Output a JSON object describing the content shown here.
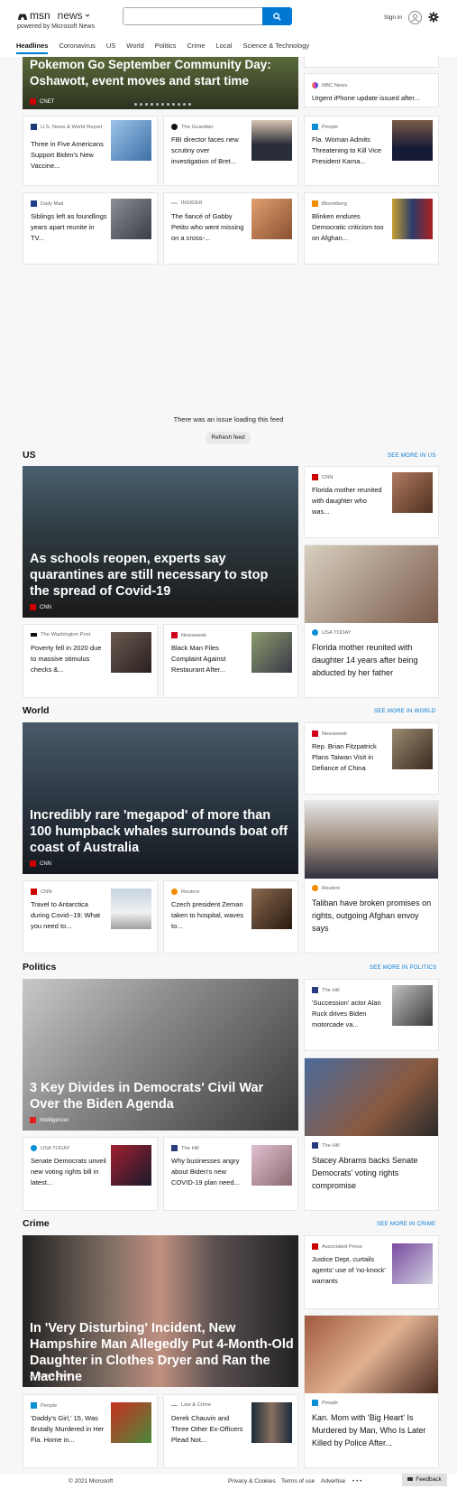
{
  "header": {
    "brand": "msn",
    "section": "news",
    "powered_by": "powered by Microsoft News",
    "search_value": "",
    "sign_in": "Sign in"
  },
  "nav": [
    "Headlines",
    "Coronavirus",
    "US",
    "World",
    "Politics",
    "Crime",
    "Local",
    "Science & Technology"
  ],
  "top": {
    "hero_title": "Pokemon Go September Community Day: Oshawott, event moves and start time",
    "hero_source": "CNET",
    "right_source": "NBC News",
    "right_title": "Urgent iPhone update issued after..."
  },
  "row1": [
    {
      "source": "U.S. News & World Report",
      "title": "Three in Five Americans Support Biden's New Vaccine..."
    },
    {
      "source": "The Guardian",
      "title": "FBI director faces new scrutiny over investigation of Bret..."
    },
    {
      "source": "People",
      "title": "Fla. Woman Admits Threatening to Kill Vice President Kama..."
    }
  ],
  "row2": [
    {
      "source": "Daily Mail",
      "title": "Siblings left as foundlings years apart reunite in TV..."
    },
    {
      "source": "INSIDER",
      "title": "The fiancé of Gabby Petito who went missing on a cross-..."
    },
    {
      "source": "Bloomberg",
      "title": "Blinken endures Democratic criticism too on Afghan..."
    }
  ],
  "feed_issue": "There was an issue loading this feed",
  "refresh": "Refresh feed",
  "sections": [
    {
      "heading": "US",
      "see_more": "SEE MORE IN US",
      "hero_title": "As schools reopen, experts say quarantines are still necessary to stop the spread of Covid-19",
      "hero_source": "CNN",
      "side_small": {
        "source": "CNN",
        "title": "Florida mother reunited with daughter who was..."
      },
      "side_big": {
        "source": "USA TODAY",
        "title": "Florida mother reunited with daughter 14 years after being abducted by her father"
      },
      "bottom": [
        {
          "source": "The Washington Post",
          "title": "Poverty fell in 2020 due to massive stimulus checks &..."
        },
        {
          "source": "Newsweek",
          "title": "Black Man Files Complaint Against Restaurant After..."
        }
      ]
    },
    {
      "heading": "World",
      "see_more": "SEE MORE IN WORLD",
      "hero_title": "Incredibly rare 'megapod' of more than 100 humpback whales surrounds boat off coast of Australia",
      "hero_source": "CNN",
      "side_small": {
        "source": "Newsweek",
        "title": "Rep. Brian Fitzpatrick Plans Taiwan Visit in Defiance of China"
      },
      "side_big": {
        "source": "Reuters",
        "title": "Taliban have broken promises on rights, outgoing Afghan envoy says"
      },
      "bottom": [
        {
          "source": "CNN",
          "title": "Travel to Antarctica during Covid--19: What you need to..."
        },
        {
          "source": "Reuters",
          "title": "Czech president Zeman taken to hospital, waves to..."
        }
      ]
    },
    {
      "heading": "Politics",
      "see_more": "SEE MORE IN POLITICS",
      "hero_title": "3 Key Divides in Democrats' Civil War Over the Biden Agenda",
      "hero_source": "Intelligencer",
      "side_small": {
        "source": "The Hill",
        "title": "'Succession' actor Alan Ruck drives Biden motorcade va..."
      },
      "side_big": {
        "source": "The Hill",
        "title": "Stacey Abrams backs Senate Democrats' voting rights compromise"
      },
      "bottom": [
        {
          "source": "USA TODAY",
          "title": "Senate Democrats unveil new voting rights bill in latest..."
        },
        {
          "source": "The Hill",
          "title": "Why businesses angry about Biden's new COVID-19 plan need..."
        }
      ]
    },
    {
      "heading": "Crime",
      "see_more": "SEE MORE IN CRIME",
      "hero_title": "In 'Very Disturbing' Incident, New Hampshire Man Allegedly Put 4-Month-Old Daughter in Clothes Dryer and Ran the Machine",
      "hero_source": "Law & Crime",
      "side_small": {
        "source": "Associated Press",
        "title": "Justice Dept. curtails agents' use of 'no-knock' warrants"
      },
      "side_big": {
        "source": "People",
        "title": "Kan. Mom with 'Big Heart' Is Murdered by Man, Who Is Later Killed by Police After..."
      },
      "bottom": [
        {
          "source": "People",
          "title": "'Daddy's Girl,' 15, Was Brutally Murdered in Her Fla. Home in..."
        },
        {
          "source": "Law & Crime",
          "title": "Derek Chauvin and Three Other Ex-Officers Plead Not..."
        }
      ]
    }
  ],
  "footer": {
    "copyright": "© 2021 Microsoft",
    "privacy": "Privacy & Cookies",
    "terms": "Terms of use",
    "advertise": "Advertise",
    "more": "• • •",
    "feedback": "Feedback"
  }
}
